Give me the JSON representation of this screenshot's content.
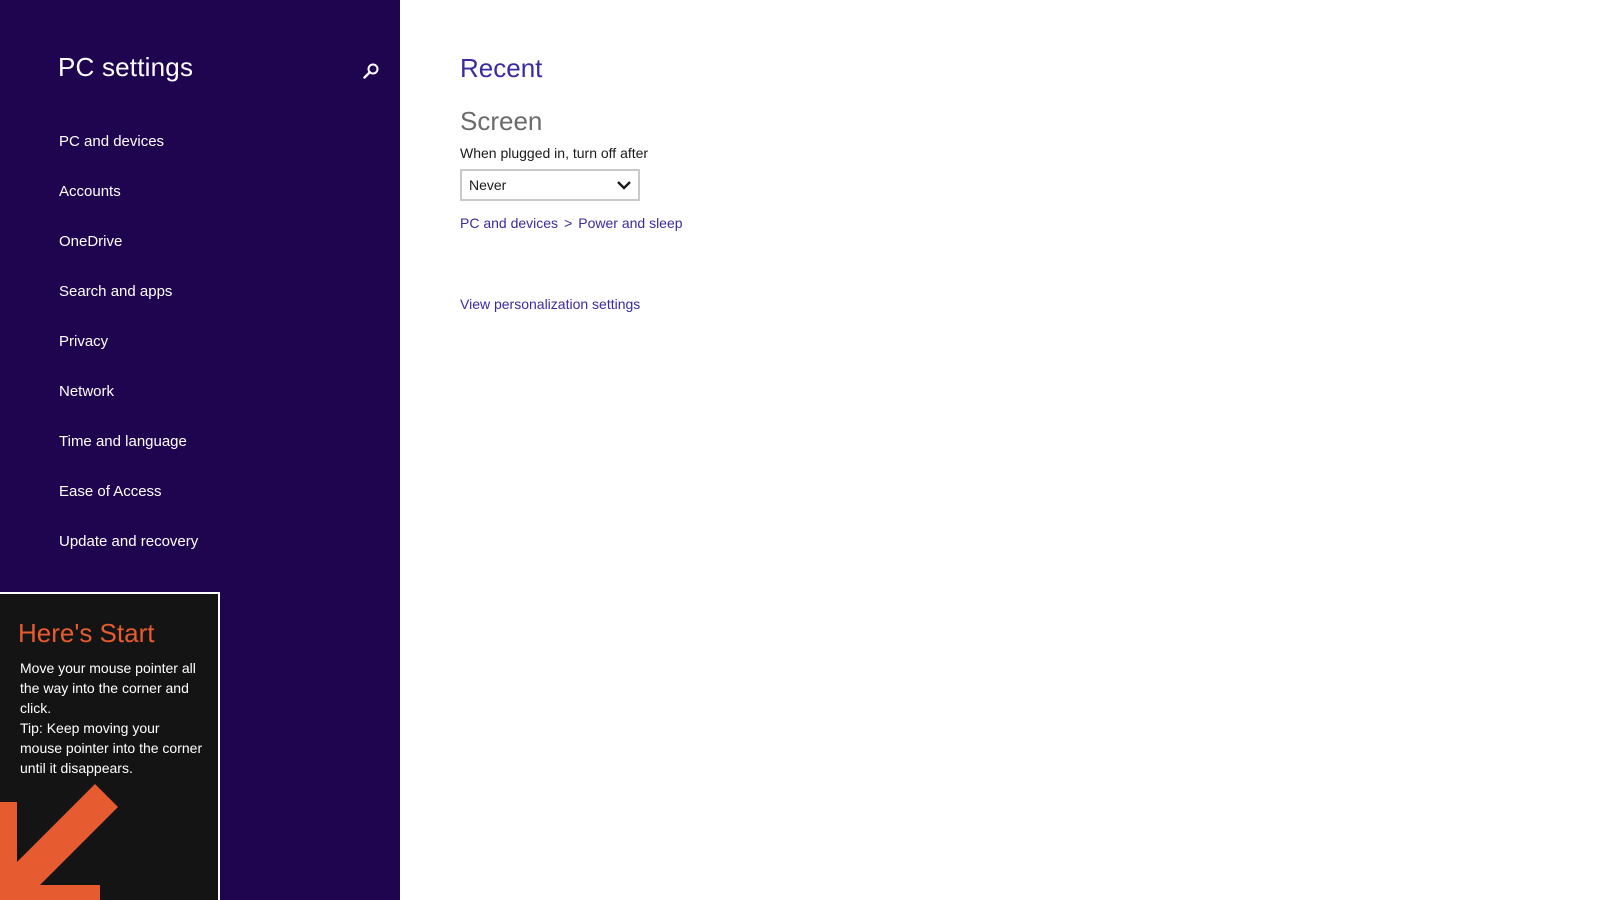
{
  "sidebar": {
    "title": "PC settings",
    "search_icon": "search-icon",
    "items": [
      {
        "label": "PC and devices"
      },
      {
        "label": "Accounts"
      },
      {
        "label": "OneDrive"
      },
      {
        "label": "Search and apps"
      },
      {
        "label": "Privacy"
      },
      {
        "label": "Network"
      },
      {
        "label": "Time and language"
      },
      {
        "label": "Ease of Access"
      },
      {
        "label": "Update and recovery"
      }
    ]
  },
  "tip": {
    "title": "Here's Start",
    "line1": "Move your mouse pointer all the way into the corner and click.",
    "line2": "Tip: Keep moving your mouse pointer into the corner until it disappears.",
    "icon": "arrow-down-left-icon"
  },
  "main": {
    "section_title": "Recent",
    "group_title": "Screen",
    "field_label": "When plugged in, turn off after",
    "select_value": "Never",
    "breadcrumb": {
      "part1": "PC and devices",
      "separator": ">",
      "part2": "Power and sleep"
    },
    "link": "View personalization settings"
  },
  "colors": {
    "sidebar_bg": "#1f0550",
    "accent": "#3b2ba0",
    "tip_title": "#e65b2f",
    "tip_bg": "#141414"
  }
}
